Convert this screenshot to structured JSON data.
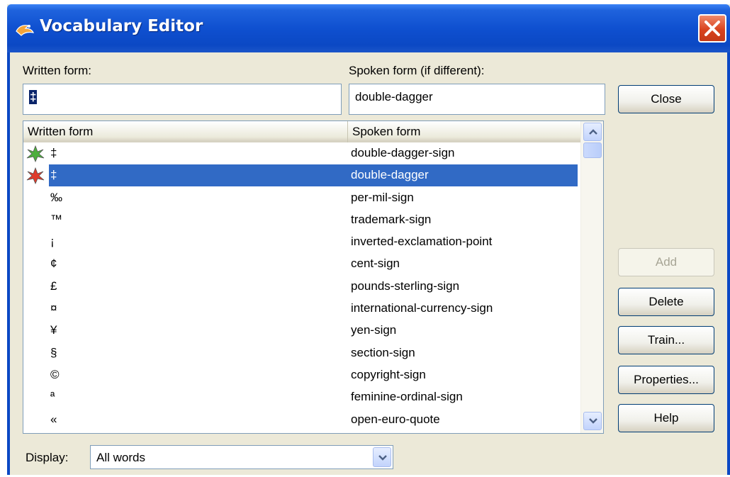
{
  "window": {
    "title": "Vocabulary Editor"
  },
  "fields": {
    "written_label": "Written form:",
    "written_value": "‡",
    "spoken_label": "Spoken form (if different):",
    "spoken_value": "double-dagger"
  },
  "list": {
    "columns": [
      "Written form",
      "Spoken form"
    ],
    "rows": [
      {
        "written": "‡",
        "spoken": "double-dagger-sign",
        "icon": "green-star-icon",
        "selected": false
      },
      {
        "written": "‡",
        "spoken": "double-dagger",
        "icon": "red-star-icon",
        "selected": true
      },
      {
        "written": "‰",
        "spoken": "per-mil-sign",
        "icon": "",
        "selected": false
      },
      {
        "written": "™",
        "spoken": "trademark-sign",
        "icon": "",
        "selected": false
      },
      {
        "written": "¡",
        "spoken": "inverted-exclamation-point",
        "icon": "",
        "selected": false
      },
      {
        "written": "¢",
        "spoken": "cent-sign",
        "icon": "",
        "selected": false
      },
      {
        "written": "£",
        "spoken": "pounds-sterling-sign",
        "icon": "",
        "selected": false
      },
      {
        "written": "¤",
        "spoken": "international-currency-sign",
        "icon": "",
        "selected": false
      },
      {
        "written": "¥",
        "spoken": "yen-sign",
        "icon": "",
        "selected": false
      },
      {
        "written": "§",
        "spoken": "section-sign",
        "icon": "",
        "selected": false
      },
      {
        "written": "©",
        "spoken": "copyright-sign",
        "icon": "",
        "selected": false
      },
      {
        "written": "ª",
        "spoken": "feminine-ordinal-sign",
        "icon": "",
        "selected": false
      },
      {
        "written": "«",
        "spoken": "open-euro-quote",
        "icon": "",
        "selected": false
      }
    ]
  },
  "buttons": {
    "close": "Close",
    "add": "Add",
    "delete": "Delete",
    "train": "Train...",
    "properties": "Properties...",
    "help": "Help"
  },
  "display": {
    "label": "Display:",
    "value": "All words"
  },
  "colors": {
    "titlebar": "#0b48c4",
    "selection": "#316ac5",
    "close_button": "#d9431e"
  }
}
